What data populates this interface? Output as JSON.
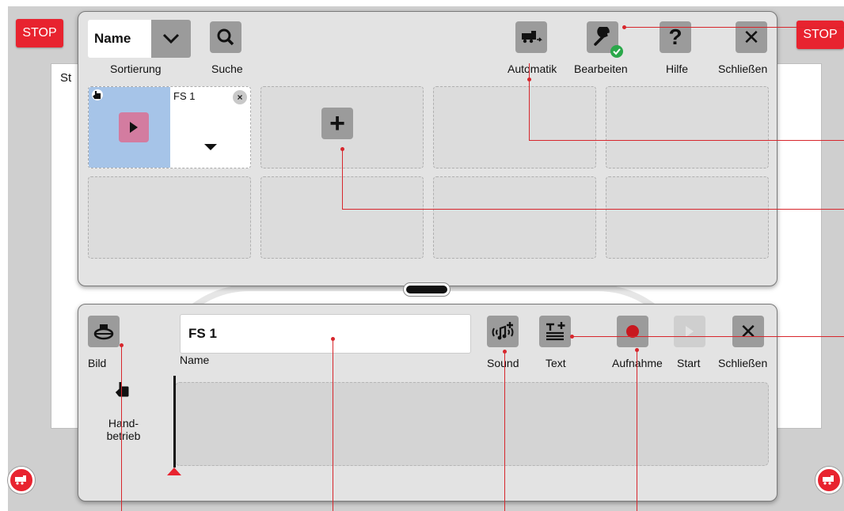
{
  "app": {
    "stop_label": "STOP",
    "background_text": "St",
    "accent_color": "#e8232f"
  },
  "top_panel": {
    "sort": {
      "value": "Name",
      "label": "Sortierung",
      "icon": "chevron-down-icon"
    },
    "search": {
      "label": "Suche",
      "icon": "search-icon"
    },
    "automatic": {
      "label": "Automatik",
      "icon": "locomotive-icon"
    },
    "edit": {
      "label": "Bearbeiten",
      "icon": "wrench-icon",
      "active": true
    },
    "help": {
      "label": "Hilfe",
      "icon": "question-icon",
      "glyph": "?"
    },
    "close": {
      "label": "Schließen",
      "icon": "close-icon",
      "glyph": "✕"
    },
    "tiles": [
      {
        "name": "FS 1",
        "type": "sequence"
      },
      {
        "type": "add",
        "glyph": "+"
      },
      {
        "type": "empty"
      },
      {
        "type": "empty"
      },
      {
        "type": "empty"
      },
      {
        "type": "empty"
      },
      {
        "type": "empty"
      },
      {
        "type": "empty"
      }
    ]
  },
  "bottom_panel": {
    "image": {
      "label": "Bild",
      "icon": "turntable-icon"
    },
    "name_field": {
      "value": "FS 1",
      "label": "Name"
    },
    "sound": {
      "label": "Sound",
      "icon": "add-sound-icon"
    },
    "text": {
      "label": "Text",
      "icon": "add-text-icon"
    },
    "record": {
      "label": "Aufnahme",
      "icon": "record-icon"
    },
    "start": {
      "label": "Start",
      "icon": "play-icon"
    },
    "close": {
      "label": "Schließen",
      "icon": "close-icon",
      "glyph": "✕"
    },
    "mode": {
      "label": "Hand-\nbetrieb",
      "icon": "hand-icon"
    }
  }
}
